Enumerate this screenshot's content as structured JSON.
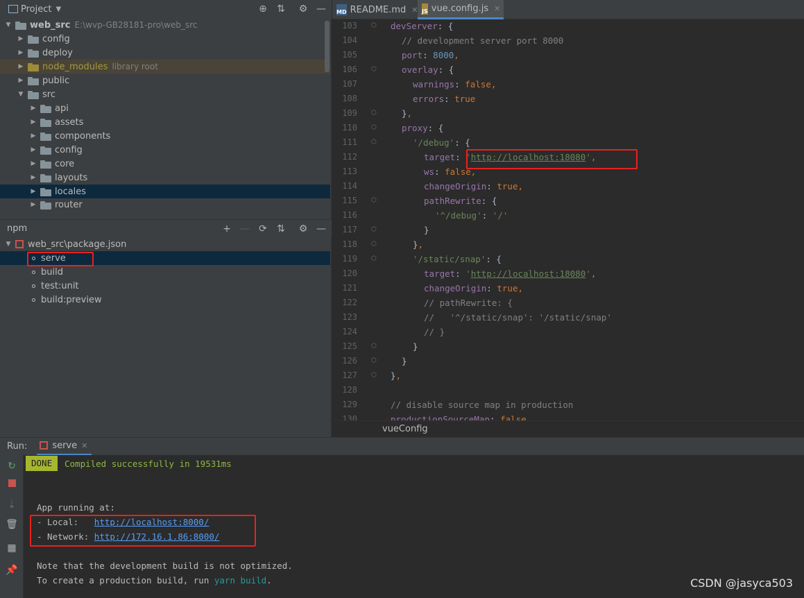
{
  "project_panel": {
    "title": "Project",
    "root_label": "web_src",
    "root_path": "E:\\wvp-GB28181-pro\\web_src",
    "items": [
      {
        "label": "config",
        "depth": 1
      },
      {
        "label": "deploy",
        "depth": 1
      },
      {
        "label": "node_modules",
        "suffix": "library root",
        "depth": 1
      },
      {
        "label": "public",
        "depth": 1
      },
      {
        "label": "src",
        "depth": 1
      },
      {
        "label": "api",
        "depth": 2
      },
      {
        "label": "assets",
        "depth": 2
      },
      {
        "label": "components",
        "depth": 2
      },
      {
        "label": "config",
        "depth": 2
      },
      {
        "label": "core",
        "depth": 2
      },
      {
        "label": "layouts",
        "depth": 2
      },
      {
        "label": "locales",
        "depth": 2
      },
      {
        "label": "router",
        "depth": 2
      }
    ]
  },
  "npm_panel": {
    "title": "npm",
    "package": "web_src\\package.json",
    "scripts": [
      "serve",
      "build",
      "test:unit",
      "build:preview"
    ]
  },
  "tabs": [
    {
      "label": "README.md",
      "icon": "MD"
    },
    {
      "label": "vue.config.js",
      "icon": "JS"
    }
  ],
  "editor": {
    "breadcrumb": "vueConfig",
    "lines": [
      {
        "n": "103",
        "text": "devServer: {"
      },
      {
        "n": "104",
        "text": "// development server port 8000"
      },
      {
        "n": "105",
        "text": "port: 8000,"
      },
      {
        "n": "106",
        "text": "overlay: {"
      },
      {
        "n": "107",
        "text": "warnings: false,"
      },
      {
        "n": "108",
        "text": "errors: true"
      },
      {
        "n": "109",
        "text": "},"
      },
      {
        "n": "110",
        "text": "proxy: {"
      },
      {
        "n": "111",
        "text": "'/debug': {"
      },
      {
        "n": "112",
        "text": "target: 'http://localhost:18080',"
      },
      {
        "n": "113",
        "text": "ws: false,"
      },
      {
        "n": "114",
        "text": "changeOrigin: true,"
      },
      {
        "n": "115",
        "text": "pathRewrite: {"
      },
      {
        "n": "116",
        "text": "'^/debug': '/'"
      },
      {
        "n": "117",
        "text": "}"
      },
      {
        "n": "118",
        "text": "},"
      },
      {
        "n": "119",
        "text": "'/static/snap': {"
      },
      {
        "n": "120",
        "text": "target: 'http://localhost:18080',"
      },
      {
        "n": "121",
        "text": "changeOrigin: true,"
      },
      {
        "n": "122",
        "text": "// pathRewrite: {"
      },
      {
        "n": "123",
        "text": "//   '^/static/snap': '/static/snap'"
      },
      {
        "n": "124",
        "text": "// }"
      },
      {
        "n": "125",
        "text": "}"
      },
      {
        "n": "126",
        "text": "}"
      },
      {
        "n": "127",
        "text": "},"
      },
      {
        "n": "128",
        "text": ""
      },
      {
        "n": "129",
        "text": "// disable source map in production"
      },
      {
        "n": "130",
        "text": "productionSourceMap: false,"
      }
    ]
  },
  "run": {
    "label": "Run:",
    "tab": "serve",
    "done_badge": "DONE",
    "compiled": "Compiled successfully in 19531ms",
    "app_running": "App running at:",
    "local_label": "- Local:   ",
    "local_url": "http://localhost:8000/",
    "network_label": "- Network: ",
    "network_url": "http://172.16.1.86:8000/",
    "note1": "Note that the development build is not optimized.",
    "note2_prefix": "To create a production build, run ",
    "note2_cmd1": "yarn",
    "note2_cmd2": "build",
    "note2_suffix": "."
  },
  "watermark": "CSDN @jasyca503",
  "colors": {
    "accent": "#4a88c7",
    "highlight_box": "#e8221f",
    "selection": "#0d293e"
  }
}
